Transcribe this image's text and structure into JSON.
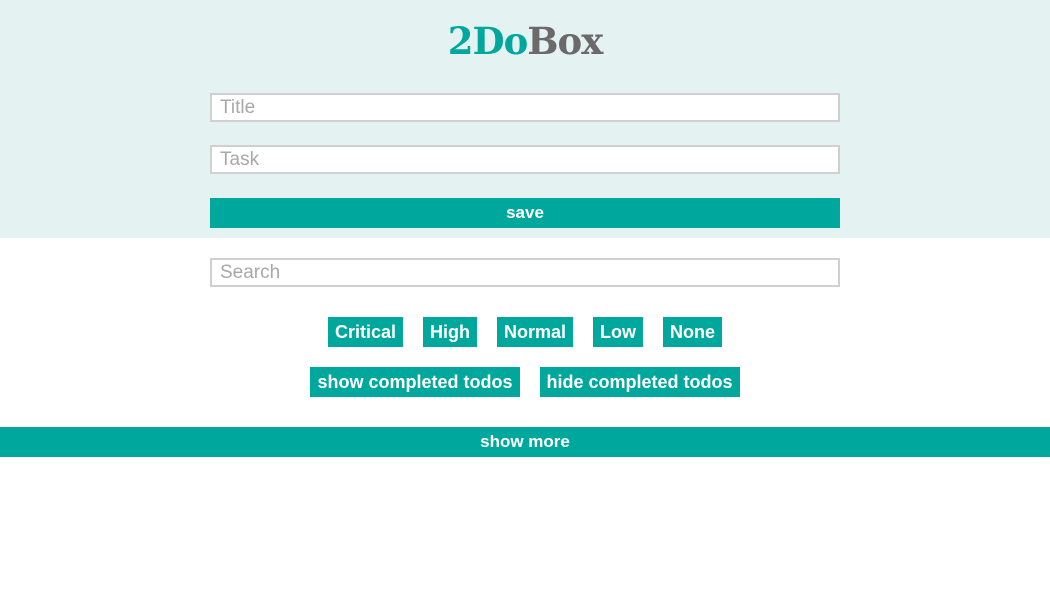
{
  "app": {
    "logo_part1": "2Do",
    "logo_part2": "Box"
  },
  "form": {
    "title_placeholder": "Title",
    "title_value": "",
    "task_placeholder": "Task",
    "task_value": "",
    "save_label": "save"
  },
  "search": {
    "placeholder": "Search",
    "value": ""
  },
  "filters": {
    "importance": [
      "Critical",
      "High",
      "Normal",
      "Low",
      "None"
    ],
    "show_completed": "show completed todos",
    "hide_completed": "hide completed todos"
  },
  "list": {
    "show_more_label": "show more"
  },
  "colors": {
    "accent": "#00a79d",
    "header_bg": "#e4f2f1",
    "logo_gray": "#6a6a6a",
    "field_border": "#d0d0d0",
    "placeholder": "#a8a8a8"
  }
}
